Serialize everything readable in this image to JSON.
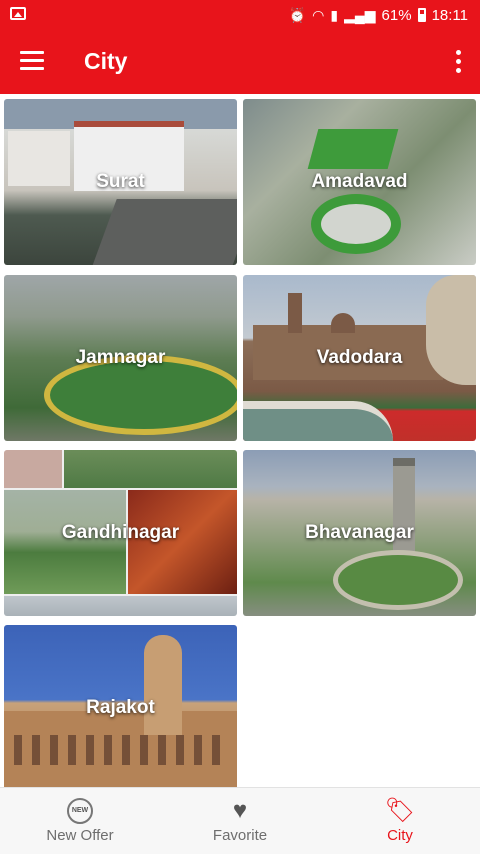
{
  "status_bar": {
    "battery": "61%",
    "time": "18:11"
  },
  "app_bar": {
    "title": "City"
  },
  "cities": [
    {
      "name": "Surat"
    },
    {
      "name": "Amadavad"
    },
    {
      "name": "Jamnagar"
    },
    {
      "name": "Vadodara"
    },
    {
      "name": "Gandhinagar"
    },
    {
      "name": "Bhavanagar"
    },
    {
      "name": "Rajakot"
    }
  ],
  "bottom_nav": {
    "items": [
      {
        "label": "New Offer",
        "icon": "new-badge-icon",
        "active": false
      },
      {
        "label": "Favorite",
        "icon": "heart-hands-icon",
        "active": false
      },
      {
        "label": "City",
        "icon": "price-tag-icon",
        "active": true
      }
    ]
  },
  "colors": {
    "primary": "#e8141b",
    "inactive_nav": "#6e6e6e"
  }
}
